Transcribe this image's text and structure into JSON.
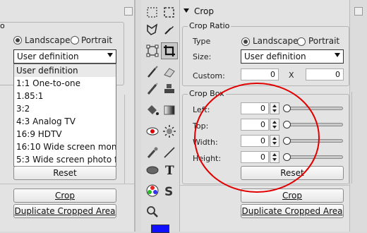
{
  "left_panel": {
    "orientation": {
      "landscape_label": "Landscape",
      "portrait_label": "Portrait",
      "selected": "Landscape"
    },
    "size_select_value": "User definition",
    "dropdown_items": [
      "User definition",
      "1:1 One-to-one",
      "1.85:1",
      "3:2",
      "4:3 Analog TV",
      "16:9 HDTV",
      "16:10 Wide screen moni...",
      "5:3 Wide screen photo f..."
    ],
    "reset_label": "Reset",
    "crop_label": "Crop",
    "duplicate_label": "Duplicate Cropped Area"
  },
  "toolbar": {
    "tools": [
      "lasso-rect-icon",
      "marquee-icon",
      "lasso-poly-icon",
      "eyedropper-icon",
      "transform-icon",
      "crop-icon",
      "brush-icon",
      "eraser-icon",
      "pencil-icon",
      "stamp-icon",
      "fill-icon",
      "gradient-icon",
      "red-eye-icon",
      "brightness-icon",
      "smudge-icon",
      "line-icon",
      "ellipse-icon",
      "text-icon",
      "color-wheel-icon",
      "shape-icon",
      "zoom-icon"
    ],
    "foreground_color": "#1010ff"
  },
  "crop_panel": {
    "header": "Crop",
    "ratio_group": {
      "title": "Crop Ratio",
      "type_label": "Type",
      "landscape_label": "Landscape",
      "portrait_label": "Portrait",
      "selected": "Landscape",
      "size_label": "Size:",
      "size_value": "User definition",
      "custom_label": "Custom:",
      "custom_w": "0",
      "times": "X",
      "custom_h": "0"
    },
    "box_group": {
      "title": "Crop Box",
      "left_label": "Left:",
      "left_value": "0",
      "top_label": "Top:",
      "top_value": "0",
      "width_label": "Width:",
      "width_value": "0",
      "height_label": "Height:",
      "height_value": "0",
      "reset_label": "Reset"
    },
    "crop_label": "Crop",
    "duplicate_label": "Duplicate Cropped Area"
  },
  "annotation": {
    "color": "#e00000"
  }
}
